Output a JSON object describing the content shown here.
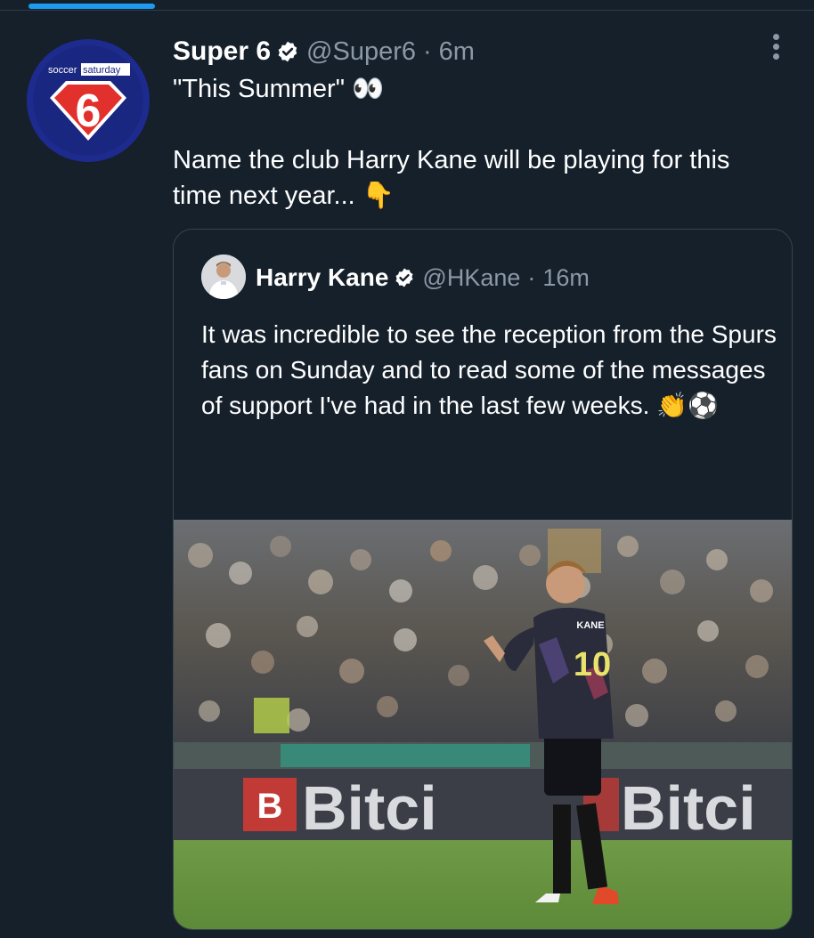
{
  "tweet": {
    "author_name": "Super 6",
    "handle": "@Super6",
    "separator": "·",
    "time": "6m",
    "line1": "\"This Summer\" 👀",
    "line2": "Name the club Harry Kane will be playing for this time next year... 👇",
    "avatar": {
      "brand_top_left": "soccer",
      "brand_top_right": "saturday",
      "emblem_number": "6"
    }
  },
  "quoted": {
    "author_name": "Harry Kane",
    "handle": "@HKane",
    "separator": "·",
    "time": "16m",
    "text": "It was incredible to see the reception from the Spurs fans on Sunday and to read some of the messages of support I've had in the last few weeks. 👏⚽",
    "ellipsis": "...",
    "photo": {
      "shirt_name": "KANE",
      "shirt_number": "10",
      "ad_text": "Bitci"
    }
  },
  "colors": {
    "background": "#15202b",
    "accent": "#1d9bf0",
    "muted": "#8b98a5",
    "border": "#38444d"
  },
  "icons": [
    "verified-badge-icon",
    "more-options-icon"
  ]
}
